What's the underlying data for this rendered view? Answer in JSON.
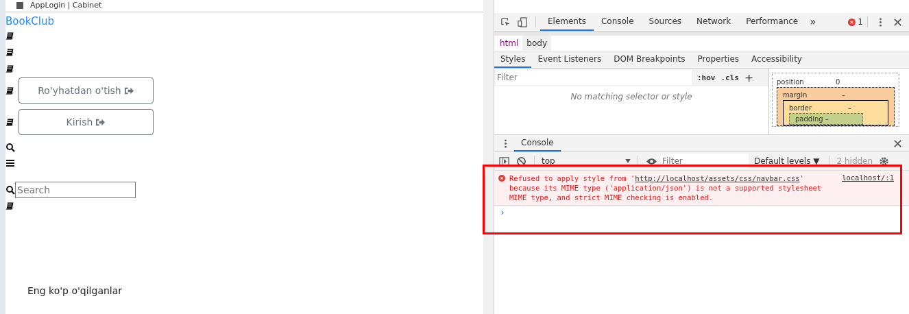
{
  "browser_tab": {
    "title": "AppLogin | Cabinet"
  },
  "page": {
    "brand": "BookClub",
    "buttons": [
      {
        "label": "Ro'yhatdan o'tish"
      },
      {
        "label": "Kirish"
      }
    ],
    "search": {
      "placeholder": "Search"
    },
    "heading": "Eng ko'p o'qilganlar"
  },
  "devtools": {
    "tabs": [
      {
        "label": "Elements",
        "selected": true
      },
      {
        "label": "Console",
        "selected": false
      },
      {
        "label": "Sources",
        "selected": false
      },
      {
        "label": "Network",
        "selected": false
      },
      {
        "label": "Performance",
        "selected": false
      }
    ],
    "more": "»",
    "error_count": "1",
    "breadcrumbs": [
      {
        "label": "html",
        "selected": false
      },
      {
        "label": "body",
        "selected": true
      }
    ],
    "subtabs": [
      {
        "label": "Styles",
        "selected": true
      },
      {
        "label": "Event Listeners",
        "selected": false
      },
      {
        "label": "DOM Breakpoints",
        "selected": false
      },
      {
        "label": "Properties",
        "selected": false
      },
      {
        "label": "Accessibility",
        "selected": false
      }
    ],
    "styles": {
      "placeholder": "Filter",
      "hov": ":hov",
      "cls": ".cls",
      "plus": "+",
      "empty": "No matching selector or style"
    },
    "box_model": {
      "position": "position",
      "position_value": "0",
      "margin": "margin",
      "margin_value": "–",
      "border": "border",
      "border_value": "–",
      "padding": "padding",
      "padding_value": "–"
    },
    "drawer": {
      "tab": "Console",
      "context": "top",
      "filter_placeholder": "Filter",
      "levels": "Default levels ▼",
      "hidden": "2 hidden",
      "messages": [
        {
          "kind": "error",
          "text_before": "Refused to apply style from '",
          "link": "http://localhost/assets/css/navbar.css",
          "text_after": "' because its MIME type ('application/json') is not a supported stylesheet MIME type, and strict MIME checking is enabled.",
          "source": "localhost/:1"
        }
      ],
      "prompt": "›"
    }
  }
}
